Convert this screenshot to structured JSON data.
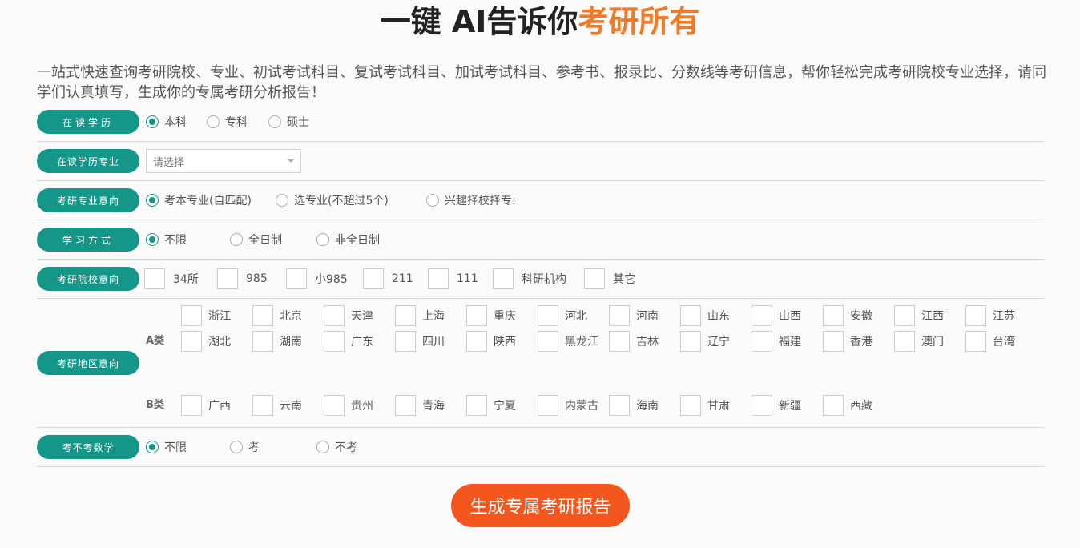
{
  "header": {
    "title_main": "一键 AI告诉你",
    "title_highlight": "考研所有",
    "intro": "一站式快速查询考研院校、专业、初试考试科目、复试考试科目、加试考试科目、参考书、报录比、分数线等考研信息，帮你轻松完成考研院校专业选择，请同学们认真填写，生成你的专属考研分析报告！"
  },
  "form": {
    "education": {
      "label": "在读学历",
      "options": [
        "本科",
        "专科",
        "硕士"
      ],
      "selected": 0
    },
    "major": {
      "label": "在读学历专业",
      "placeholder": "请选择"
    },
    "intent": {
      "label": "考研专业意向",
      "options": [
        "考本专业(自匹配)",
        "选专业(不超过5个)",
        "兴趣择校择专:"
      ],
      "selected": 0
    },
    "study_mode": {
      "label": "学习方式",
      "options": [
        "不限",
        "全日制",
        "非全日制"
      ],
      "selected": 0
    },
    "school": {
      "label": "考研院校意向",
      "options": [
        "34所",
        "985",
        "小985",
        "211",
        "111",
        "科研机构",
        "其它"
      ]
    },
    "region": {
      "label": "考研地区意向",
      "a_label": "A类",
      "a_items": [
        "浙江",
        "北京",
        "天津",
        "上海",
        "重庆",
        "河北",
        "河南",
        "山东",
        "山西",
        "安徽",
        "江西",
        "江苏",
        "湖北",
        "湖南",
        "广东",
        "四川",
        "陕西",
        "黑龙江",
        "吉林",
        "辽宁",
        "福建",
        "香港",
        "澳门",
        "台湾"
      ],
      "b_label": "B类",
      "b_items": [
        "广西",
        "云南",
        "贵州",
        "青海",
        "宁夏",
        "内蒙古",
        "海南",
        "甘肃",
        "新疆",
        "西藏"
      ]
    },
    "math": {
      "label": "考不考数学",
      "options": [
        "不限",
        "考",
        "不考"
      ],
      "selected": 0
    }
  },
  "submit": {
    "label": "生成专属考研报告"
  },
  "colors": {
    "accent": "#149688",
    "highlight": "#f07a28",
    "button": "#f4571d"
  }
}
